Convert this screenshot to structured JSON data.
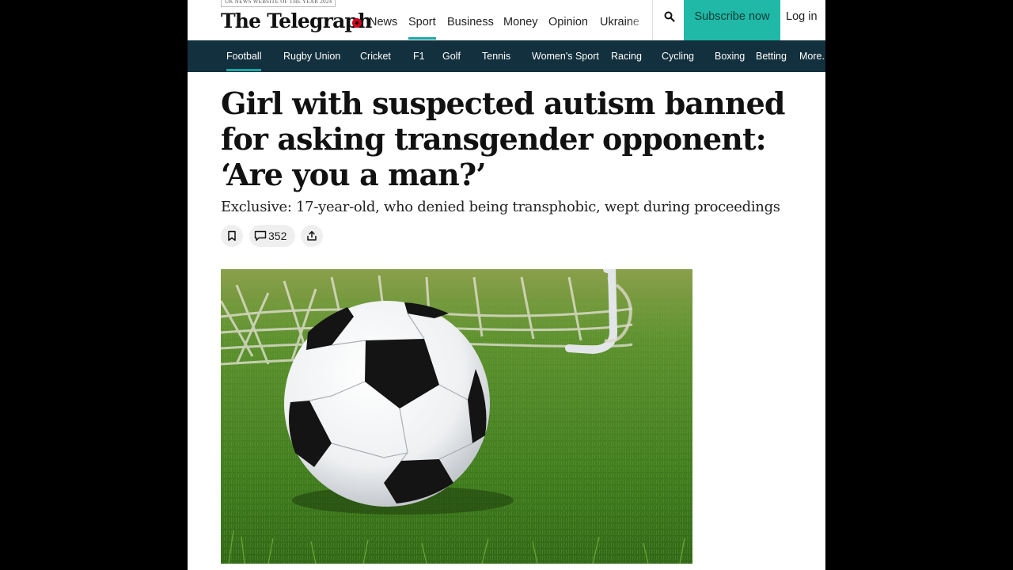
{
  "header": {
    "award": "UK NEWS WEBSITE OF THE YEAR 2024",
    "logo": "The Telegraph",
    "nav": [
      "News",
      "Sport",
      "Business",
      "Money",
      "Opinion",
      "Ukraine"
    ],
    "active_nav": "Sport",
    "subscribe_label": "Subscribe now",
    "login_label": "Log in",
    "search_icon": "search-icon"
  },
  "sport_nav": {
    "items": [
      "Football",
      "Rugby Union",
      "Cricket",
      "F1",
      "Golf",
      "Tennis",
      "Women's Sport",
      "Racing",
      "Cycling",
      "Boxing",
      "Betting",
      "More."
    ],
    "active": "Football"
  },
  "article": {
    "headline": "Girl with suspected autism banned for asking transgender opponent: ‘Are you a man?’",
    "standfirst": "Exclusive: 17-year-old, who denied being transphobic, wept during proceedings",
    "comment_count": "352",
    "icons": [
      "bookmark-icon",
      "comment-icon",
      "share-icon"
    ]
  },
  "colors": {
    "accent": "#20b8a6",
    "sport_nav_bg": "#13303e",
    "page_bg": "#000000"
  }
}
